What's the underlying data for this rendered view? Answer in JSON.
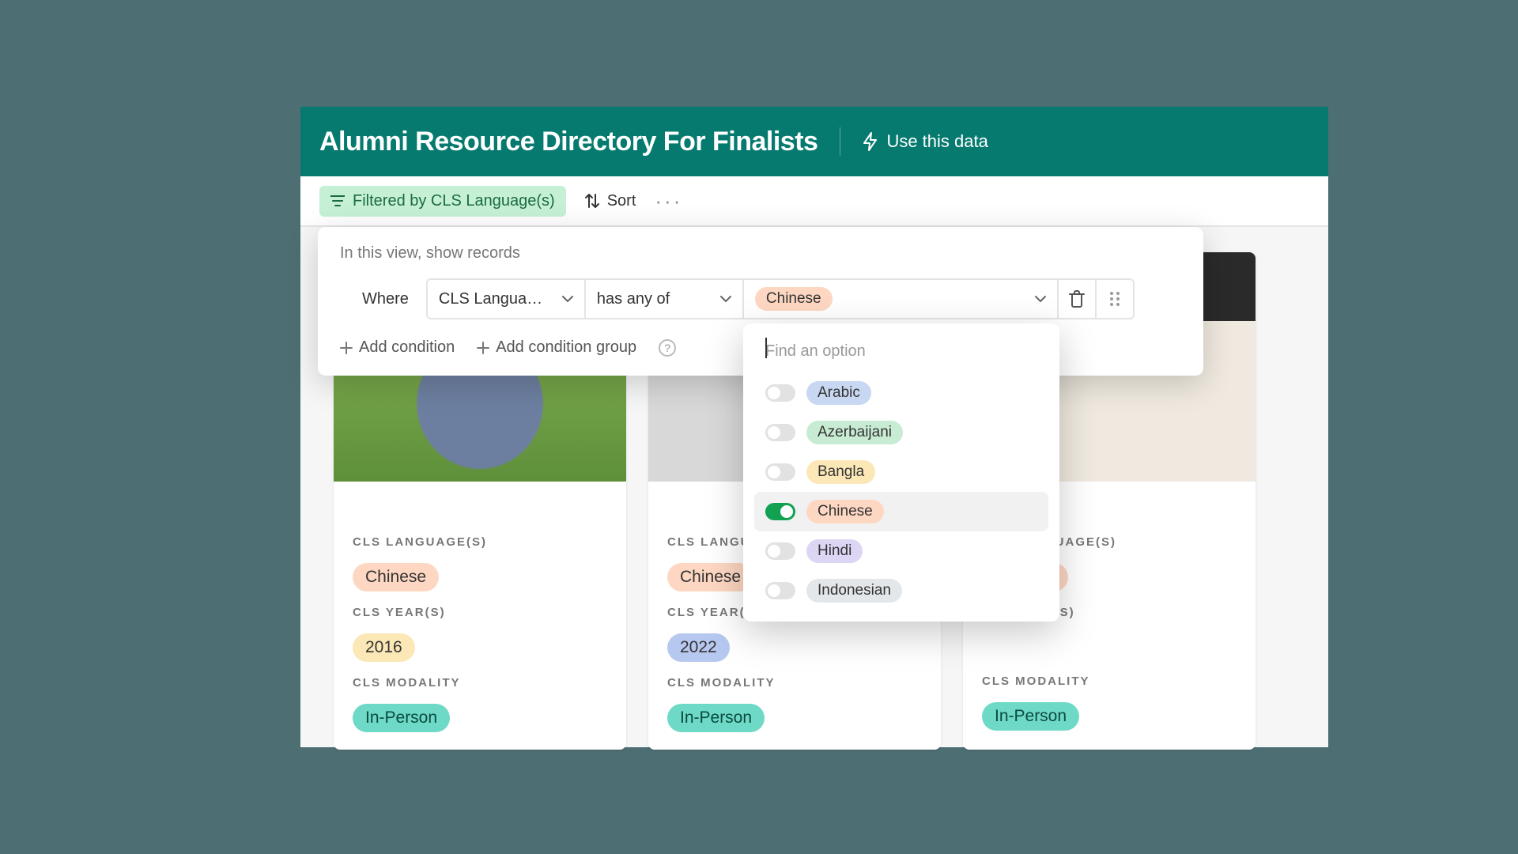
{
  "header": {
    "title": "Alumni Resource Directory For Finalists",
    "use_data": "Use this data"
  },
  "toolbar": {
    "filter_label": "Filtered by CLS Language(s)",
    "sort_label": "Sort"
  },
  "filter_panel": {
    "hint": "In this view, show records",
    "where": "Where",
    "field": "CLS Langua…",
    "operator": "has any of",
    "value": "Chinese",
    "add_condition": "Add condition",
    "add_condition_group": "Add condition group"
  },
  "options": {
    "search_placeholder": "Find an option",
    "items": [
      {
        "label": "Arabic",
        "on": false,
        "color": "blue"
      },
      {
        "label": "Azerbaijani",
        "on": false,
        "color": "green"
      },
      {
        "label": "Bangla",
        "on": false,
        "color": "yellow"
      },
      {
        "label": "Chinese",
        "on": true,
        "color": "peach"
      },
      {
        "label": "Hindi",
        "on": false,
        "color": "lilac"
      },
      {
        "label": "Indonesian",
        "on": false,
        "color": "gray"
      }
    ]
  },
  "card_labels": {
    "language": "CLS LANGUAGE(S)",
    "year": "CLS YEAR(S)",
    "modality": "CLS MODALITY"
  },
  "cards": [
    {
      "language": "Chinese",
      "year": "2016",
      "year_color": "yellow",
      "modality": "In-Person"
    },
    {
      "language": "Chinese",
      "year": "2022",
      "year_color": "bluepill",
      "modality": "In-Person"
    },
    {
      "language": "Chinese",
      "year": "",
      "year_color": "",
      "modality": "In-Person"
    }
  ]
}
